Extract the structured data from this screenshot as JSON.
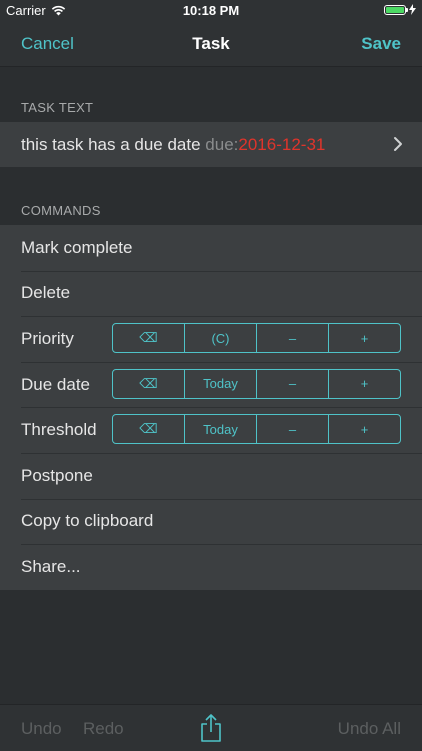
{
  "status_bar": {
    "carrier": "Carrier",
    "time": "10:18 PM"
  },
  "nav": {
    "cancel": "Cancel",
    "title": "Task",
    "save": "Save"
  },
  "task_section": {
    "header": "TASK TEXT",
    "text": "this task has a due date",
    "due_label": "due:",
    "due_value": "2016-12-31"
  },
  "commands_section": {
    "header": "COMMANDS",
    "mark_complete": "Mark complete",
    "delete": "Delete",
    "priority": {
      "label": "Priority",
      "buttons": [
        "⌫",
        "(C)",
        "–",
        "+"
      ]
    },
    "due_date": {
      "label": "Due date",
      "buttons": [
        "⌫",
        "Today",
        "–",
        "+"
      ]
    },
    "threshold": {
      "label": "Threshold",
      "buttons": [
        "⌫",
        "Today",
        "–",
        "+"
      ]
    },
    "postpone": "Postpone",
    "copy": "Copy to clipboard",
    "share": "Share..."
  },
  "toolbar": {
    "undo": "Undo",
    "redo": "Redo",
    "undo_all": "Undo All"
  },
  "colors": {
    "accent": "#4fc3c8",
    "due_value": "#e0342b",
    "background": "#2b2e30",
    "row": "#3c3f41"
  }
}
